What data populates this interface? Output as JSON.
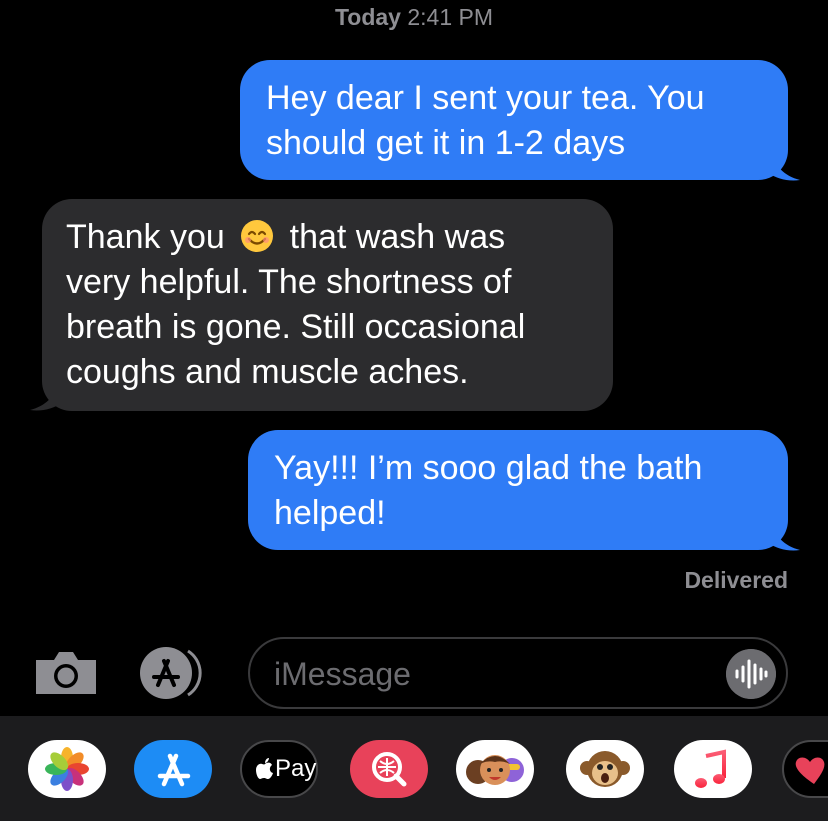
{
  "header": {
    "day": "Today",
    "time": "2:41 PM"
  },
  "messages": [
    {
      "direction": "sent",
      "lines": [
        "Hey dear I sent your tea. You",
        "should get it in 1-2 days"
      ]
    },
    {
      "direction": "received",
      "line1_before_emoji": "Thank you",
      "emoji": "smiling-face-icon",
      "line1_after_emoji": "that wash was",
      "lines_rest": [
        "very helpful. The shortness of",
        "breath is gone. Still occasional",
        "coughs and muscle aches."
      ]
    },
    {
      "direction": "sent",
      "lines": [
        "Yay!!! I’m sooo glad the bath",
        "helped!"
      ]
    }
  ],
  "status": {
    "delivered": "Delivered"
  },
  "composer": {
    "placeholder": "iMessage"
  },
  "app_drawer": {
    "apple_pay_label": "Pay",
    "apps": [
      "photos-icon",
      "app-store-icon",
      "apple-pay-icon",
      "image-search-icon",
      "memoji-icon",
      "animoji-icon",
      "music-icon",
      "digital-touch-icon"
    ]
  },
  "colors": {
    "sent_bubble": "#2f7cf6",
    "received_bubble": "#2c2c2e",
    "background": "#000000",
    "secondary_text": "#8e8e93"
  }
}
